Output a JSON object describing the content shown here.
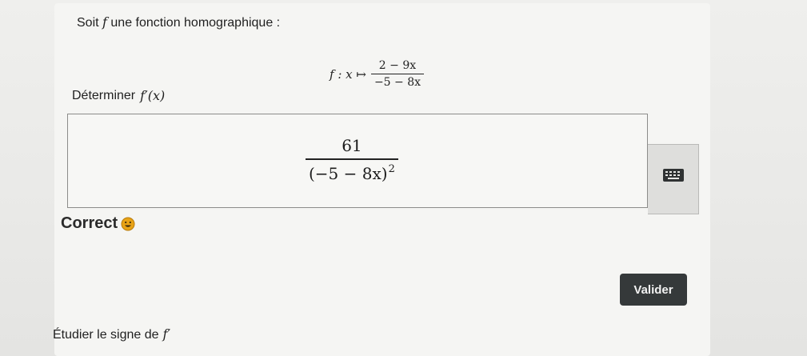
{
  "intro": {
    "text_before": "Soit",
    "function_name": "f",
    "text_after": "une fonction homographique :"
  },
  "definition": {
    "lhs": "f : x ↦",
    "numerator": "2 − 9x",
    "denominator": "−5 − 8x"
  },
  "question": {
    "text": "Déterminer",
    "expression": "f′(x)"
  },
  "answer": {
    "numerator": "61",
    "denominator": "(−5 − 8x)",
    "exponent": "2"
  },
  "keyboard_toggle": {
    "icon": "keyboard-icon"
  },
  "feedback": {
    "label": "Correct",
    "icon": "smiley-icon",
    "icon_color": "#e8a317"
  },
  "validate_button": {
    "label": "Valider",
    "color": "#35393a"
  },
  "next_section": {
    "text": "Étudier le signe de",
    "expression": "f′"
  }
}
